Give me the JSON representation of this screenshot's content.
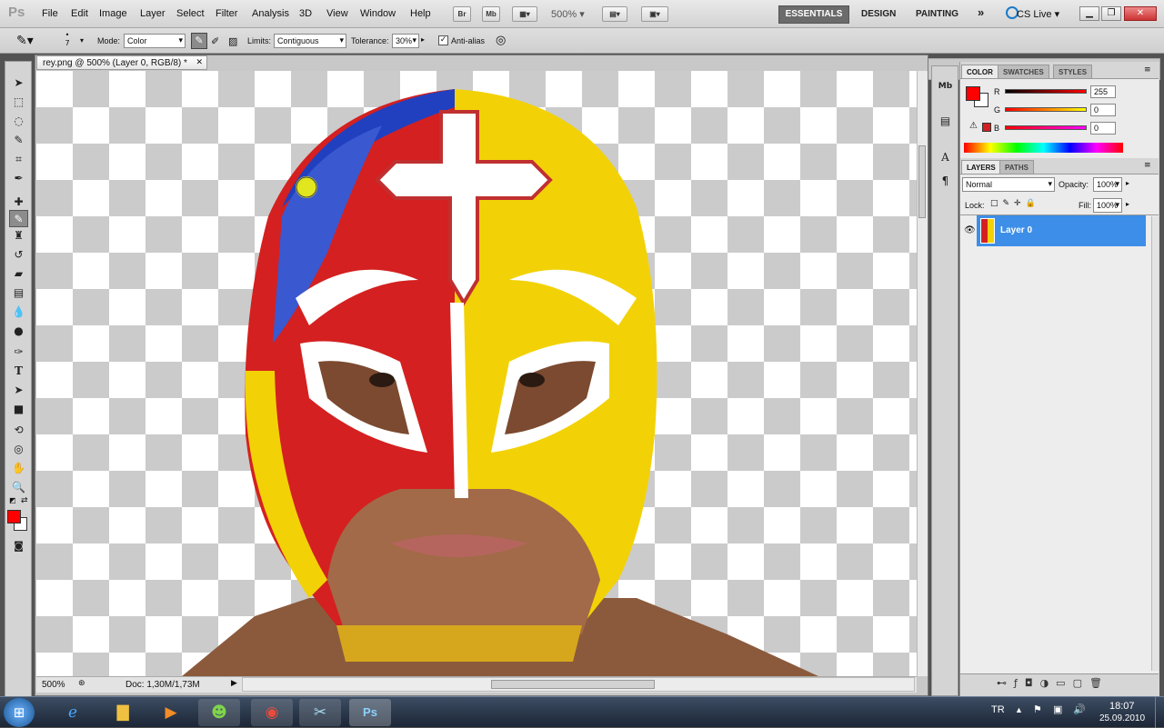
{
  "app": {
    "logo": "Ps"
  },
  "menu": [
    "File",
    "Edit",
    "Image",
    "Layer",
    "Select",
    "Filter",
    "Analysis",
    "3D",
    "View",
    "Window",
    "Help"
  ],
  "toolbar_top": {
    "bridge": "Br",
    "minibridge": "Mb",
    "zoom": "500%"
  },
  "workspaces": {
    "active": "ESSENTIALS",
    "others": [
      "DESIGN",
      "PAINTING"
    ],
    "more": "»"
  },
  "cs_live": "CS Live",
  "options": {
    "brush_size": "7",
    "mode_label": "Mode:",
    "mode_value": "Color",
    "limits_label": "Limits:",
    "limits_value": "Contiguous",
    "tolerance_label": "Tolerance:",
    "tolerance_value": "30%",
    "antialias_label": "Anti-alias"
  },
  "document": {
    "tab_title": "rey.png @ 500% (Layer 0, RGB/8) *",
    "zoom_status": "500%",
    "doc_info": "Doc: 1,30M/1,73M"
  },
  "color_panel": {
    "tabs": [
      "COLOR",
      "SWATCHES",
      "STYLES"
    ],
    "r_label": "R",
    "r_value": "255",
    "g_label": "G",
    "g_value": "0",
    "b_label": "B",
    "b_value": "0",
    "foreground": "#ff0000"
  },
  "layers_panel": {
    "tabs": [
      "LAYERS",
      "PATHS"
    ],
    "blend_mode": "Normal",
    "opacity_label": "Opacity:",
    "opacity_value": "100%",
    "lock_label": "Lock:",
    "fill_label": "Fill:",
    "fill_value": "100%",
    "layer_name": "Layer 0"
  },
  "taskbar": {
    "language": "TR",
    "time": "18:07",
    "date": "25.09.2010"
  }
}
